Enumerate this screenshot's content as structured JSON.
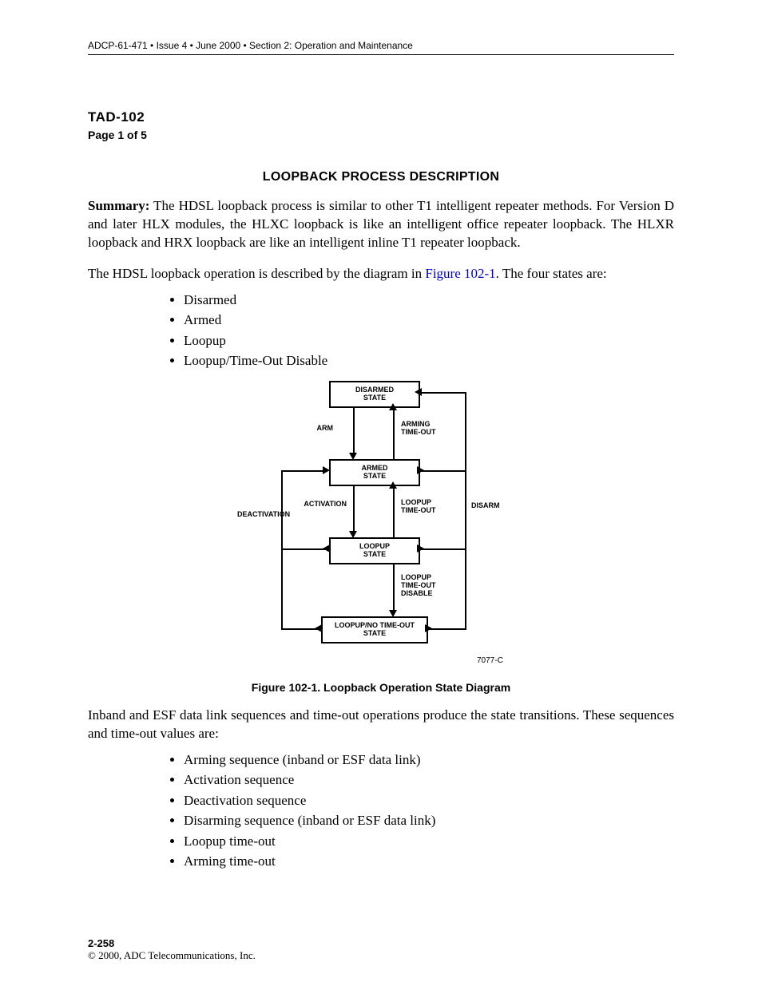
{
  "header": "ADCP-61-471 • Issue 4 • June 2000 • Section 2: Operation and Maintenance",
  "tad": {
    "code": "TAD-102",
    "page": "Page 1 of 5"
  },
  "section_title": "LOOPBACK PROCESS DESCRIPTION",
  "summary": {
    "label": "Summary:",
    "text": " The HDSL loopback process is similar to other T1 intelligent repeater methods. For Version D and later HLX modules, the HLXC loopback is like an intelligent office repeater loopback. The HLXR loopback and HRX loopback are like an intelligent inline T1 repeater loopback."
  },
  "para2": {
    "pre": "The HDSL loopback operation is described by the diagram in ",
    "link": "Figure 102-1",
    "post": ". The four states are:"
  },
  "states": [
    "Disarmed",
    "Armed",
    "Loopup",
    "Loopup/Time-Out Disable"
  ],
  "diagram": {
    "boxes": {
      "disarmed": "DISARMED\nSTATE",
      "armed": "ARMED\nSTATE",
      "loopup": "LOOPUP\nSTATE",
      "notimeout": "LOOPUP/NO TIME-OUT\nSTATE"
    },
    "labels": {
      "arm": "ARM",
      "arming_to": "ARMING\nTIME-OUT",
      "activation": "ACTIVATION",
      "loopup_to": "LOOPUP\nTIME-OUT",
      "deactivation": "DEACTIVATION",
      "disarm": "DISARM",
      "loopup_to_dis": "LOOPUP\nTIME-OUT\nDISABLE"
    },
    "code": "7077-C"
  },
  "fig_caption": "Figure 102-1. Loopback Operation State Diagram",
  "para3": "Inband and ESF data link sequences and time-out operations produce the state transitions. These sequences and time-out values are:",
  "seqs": [
    "Arming sequence (inband or ESF data link)",
    "Activation sequence",
    "Deactivation sequence",
    "Disarming sequence (inband or ESF data link)",
    "Loopup time-out",
    "Arming time-out"
  ],
  "footer": {
    "page": "2-258",
    "copyright": "© 2000, ADC Telecommunications, Inc."
  }
}
